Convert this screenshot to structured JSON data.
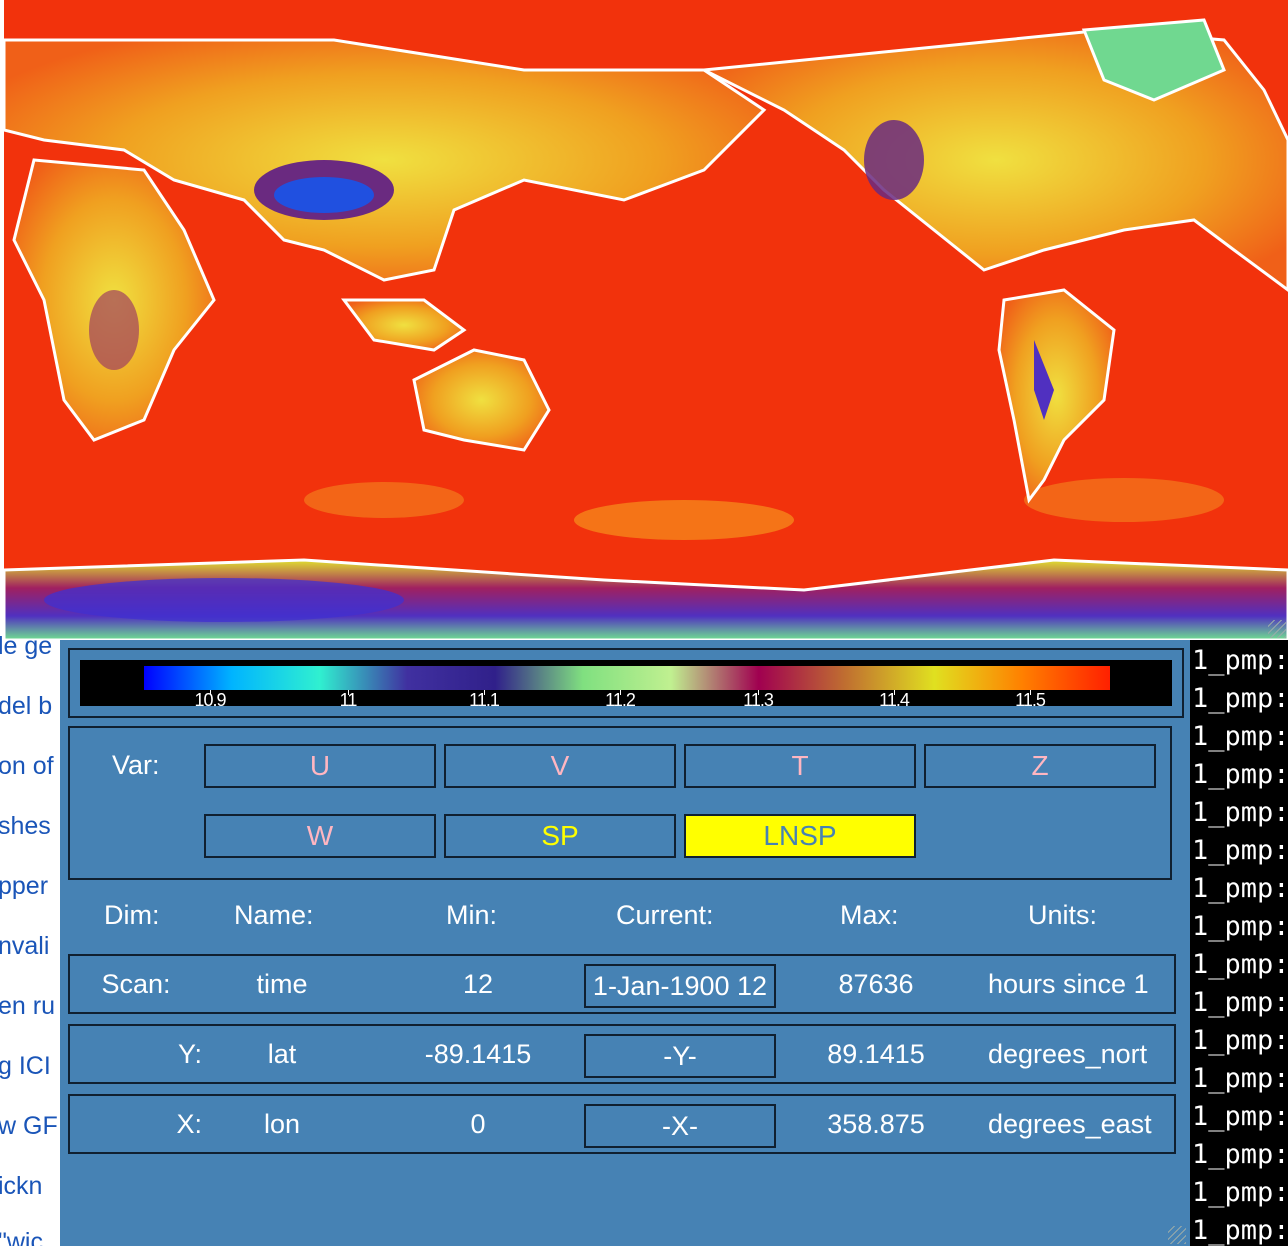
{
  "background_page": {
    "fragments": [
      "le ge",
      "del b",
      "on of",
      "shes",
      "pper",
      "nvali",
      "en ru",
      "g ICI",
      "w GF",
      "ickn",
      "\"wic"
    ]
  },
  "terminal": {
    "lines": [
      "1_pmp:",
      "1_pmp:",
      "1_pmp:",
      "1_pmp:",
      "1_pmp:",
      "1_pmp:",
      "1_pmp:",
      "1_pmp:",
      "1_pmp:",
      "1_pmp:",
      "1_pmp:",
      "1_pmp:",
      "1_pmp:",
      "1_pmp:",
      "1_pmp:",
      "1_pmp:"
    ]
  },
  "colorbar": {
    "labels": [
      "10.9",
      "11",
      "11.1",
      "11.2",
      "11.3",
      "11.4",
      "11.5"
    ],
    "stops": [
      "#0000ff",
      "#00b4ff",
      "#30f0d0",
      "#4030a0",
      "#30208a",
      "#80e080",
      "#c0f090",
      "#a00050",
      "#c07030",
      "#e0e020",
      "#ff8000",
      "#ff2000"
    ]
  },
  "variables": {
    "label": "Var:",
    "buttons": [
      "U",
      "V",
      "T",
      "Z",
      "W",
      "SP",
      "LNSP"
    ],
    "selected": "LNSP"
  },
  "dimensions": {
    "headers": {
      "dim": "Dim:",
      "name": "Name:",
      "min": "Min:",
      "current": "Current:",
      "max": "Max:",
      "units": "Units:"
    },
    "rows": [
      {
        "dim": "Scan:",
        "name": "time",
        "min": "12",
        "current": "1-Jan-1900 12",
        "max": "87636",
        "units": "hours since 1"
      },
      {
        "dim": "Y:",
        "name": "lat",
        "min": "-89.1415",
        "current": "-Y-",
        "max": "89.1415",
        "units": "degrees_nort"
      },
      {
        "dim": "X:",
        "name": "lon",
        "min": "0",
        "current": "-X-",
        "max": "358.875",
        "units": "degrees_east"
      }
    ]
  },
  "colors": {
    "panel": "#4682b4",
    "active_button": "#ffff00",
    "button_text": "#ffb6c1",
    "map_ocean": "#f2320c",
    "coastline": "#ffffff"
  }
}
